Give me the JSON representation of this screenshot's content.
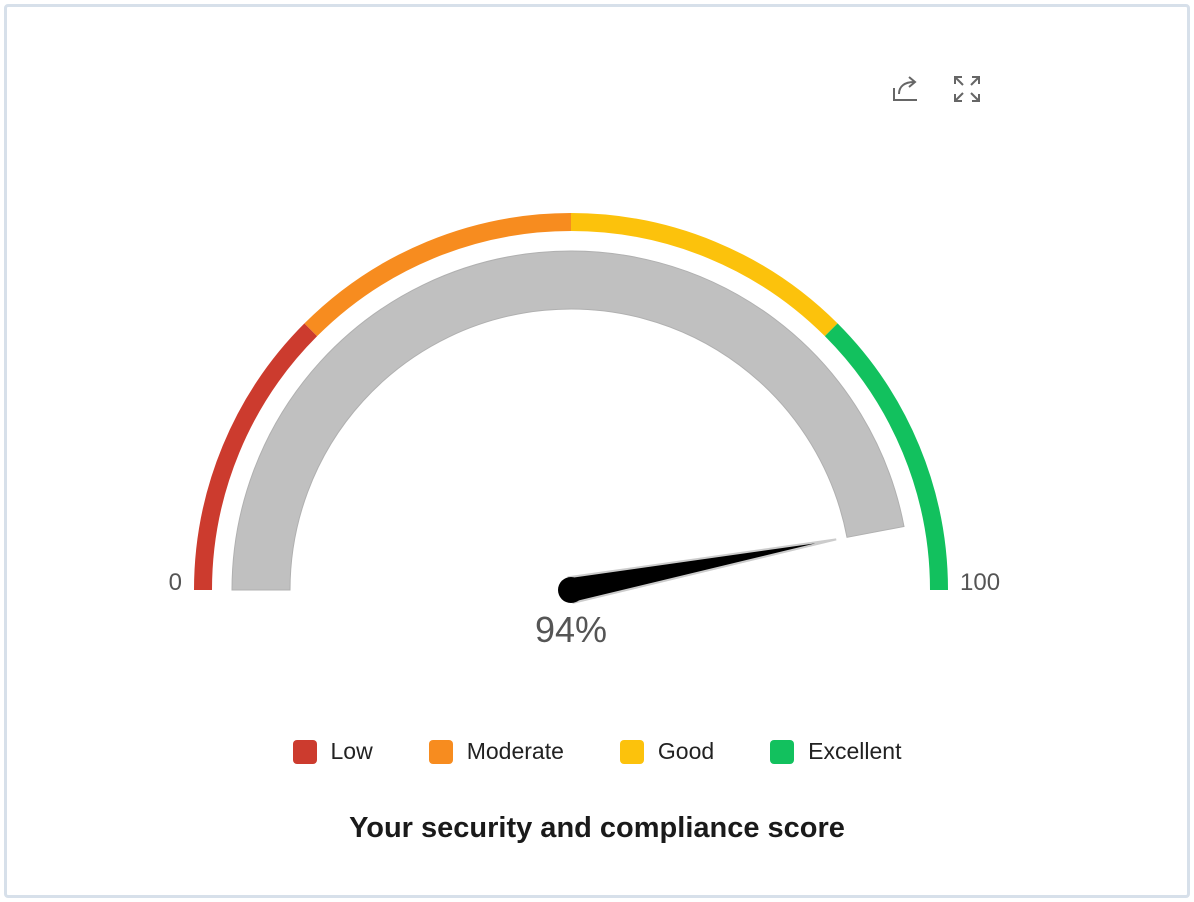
{
  "toolbar": {
    "share_icon": "share-icon",
    "fullscreen_icon": "fullscreen-icon"
  },
  "chart_data": {
    "type": "gauge",
    "title": "Your security and compliance score",
    "value": 94,
    "value_label": "94%",
    "min": 0,
    "max": 100,
    "min_label": "0",
    "max_label": "100",
    "bands": [
      {
        "name": "Low",
        "from": 0,
        "to": 25,
        "color": "#cc3b2e"
      },
      {
        "name": "Moderate",
        "from": 25,
        "to": 50,
        "color": "#f78c1f"
      },
      {
        "name": "Good",
        "from": 50,
        "to": 75,
        "color": "#fcc20c"
      },
      {
        "name": "Excellent",
        "from": 75,
        "to": 100,
        "color": "#12c15e"
      }
    ],
    "track_color": "#c0c0c0",
    "needle_color": "#000000",
    "legend_position": "bottom"
  }
}
